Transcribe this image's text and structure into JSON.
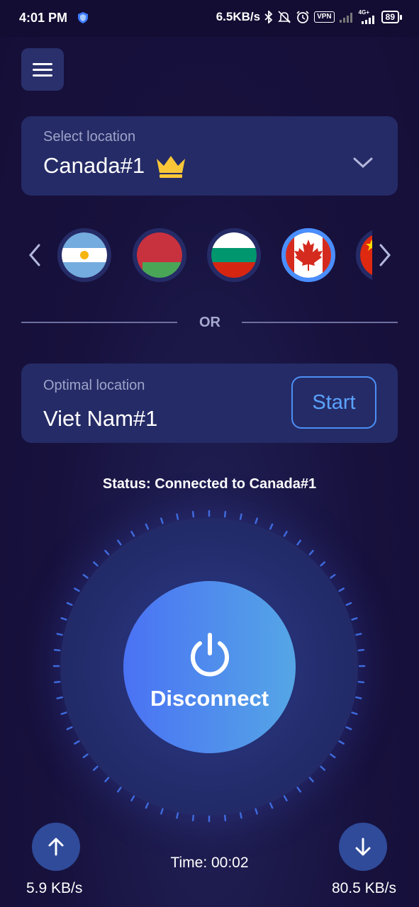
{
  "status_bar": {
    "time": "4:01 PM",
    "net_speed": "6.5KB/s",
    "vpn_badge": "VPN",
    "network": "4G+",
    "battery": "89"
  },
  "menu": {
    "icon": "hamburger-menu-icon"
  },
  "select_location": {
    "label": "Select location",
    "value": "Canada#1",
    "premium_icon": "crown-icon",
    "dropdown_icon": "chevron-down-icon"
  },
  "flags": [
    {
      "country": "Argentina",
      "selected": false
    },
    {
      "country": "Belarus",
      "selected": false
    },
    {
      "country": "Bulgaria",
      "selected": false
    },
    {
      "country": "Canada",
      "selected": true
    },
    {
      "country": "China",
      "selected": false
    }
  ],
  "divider": {
    "text": "OR"
  },
  "optimal_location": {
    "label": "Optimal location",
    "value": "Viet Nam#1",
    "button_label": "Start"
  },
  "status": {
    "text": "Status: Connected to Canada#1"
  },
  "connect_button": {
    "label": "Disconnect",
    "icon": "power-icon"
  },
  "stats": {
    "upload_speed": "5.9 KB/s",
    "download_speed": "80.5 KB/s",
    "time": "Time: 00:02"
  },
  "colors": {
    "background": "#17113d",
    "card": "#252b66",
    "accent": "#4a8eff",
    "button_gradient_start": "#4a72f4",
    "button_gradient_end": "#55a6e6"
  }
}
